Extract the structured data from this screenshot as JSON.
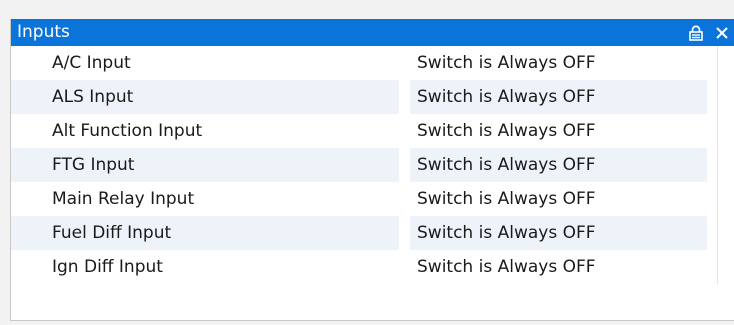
{
  "panel": {
    "title": "Inputs",
    "icons": [
      "lock-icon",
      "close-icon"
    ]
  },
  "inputs": [
    {
      "name": "A/C Input",
      "value": "Switch is Always OFF"
    },
    {
      "name": "ALS Input",
      "value": "Switch is Always OFF"
    },
    {
      "name": "Alt Function Input",
      "value": "Switch is Always OFF"
    },
    {
      "name": "FTG Input",
      "value": "Switch is Always OFF"
    },
    {
      "name": "Main Relay Input",
      "value": "Switch is Always OFF"
    },
    {
      "name": "Fuel Diff Input",
      "value": "Switch is Always OFF"
    },
    {
      "name": "Ign Diff Input",
      "value": "Switch is Always OFF"
    }
  ],
  "colors": {
    "titlebar": "#0a74da",
    "title_text": "#ffffff",
    "alt_row": "#eef3fa"
  }
}
